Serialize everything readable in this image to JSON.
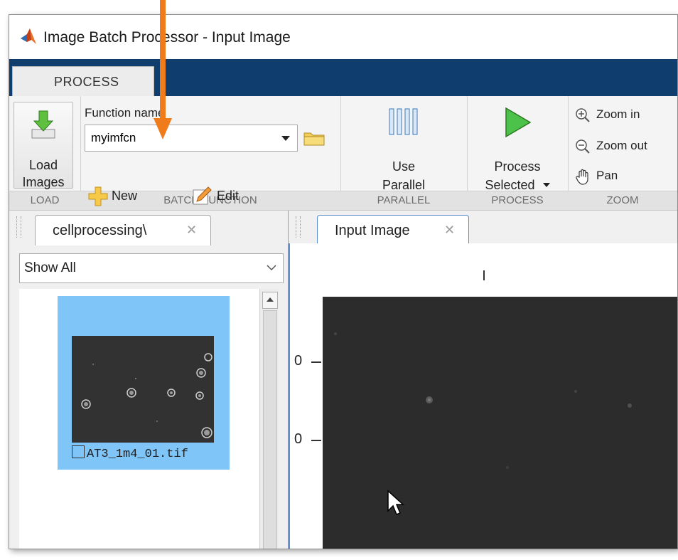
{
  "window": {
    "title": "Image Batch Processor - Input Image"
  },
  "ribbon": {
    "tab": "PROCESS",
    "groups": {
      "load": {
        "label": "LOAD",
        "button": "Load Images"
      },
      "batch_function": {
        "label": "BATCH FUNCTION",
        "function_name_label": "Function name",
        "function_value": "myimfcn",
        "new_label": "New",
        "edit_label": "Edit"
      },
      "parallel": {
        "label": "PARALLEL",
        "button_line1": "Use",
        "button_line2": "Parallel"
      },
      "process": {
        "label": "PROCESS",
        "button_line1": "Process",
        "button_line2": "Selected"
      },
      "zoom": {
        "label": "ZOOM",
        "zoom_in": "Zoom in",
        "zoom_out": "Zoom out",
        "pan": "Pan"
      }
    }
  },
  "left_panel": {
    "tab_label": "cellprocessing\\",
    "filter_value": "Show All",
    "thumbnails": [
      {
        "filename": "AT3_1m4_01.tif",
        "selected": true
      }
    ]
  },
  "right_panel": {
    "tab_label": "Input Image",
    "y_tick_labels": [
      "0",
      "0"
    ]
  },
  "colors": {
    "ribbon_bar": "#0f3d6e",
    "selection": "#80c5f7",
    "annotation_arrow": "#f07b1b",
    "process_green": "#4cc24a"
  }
}
